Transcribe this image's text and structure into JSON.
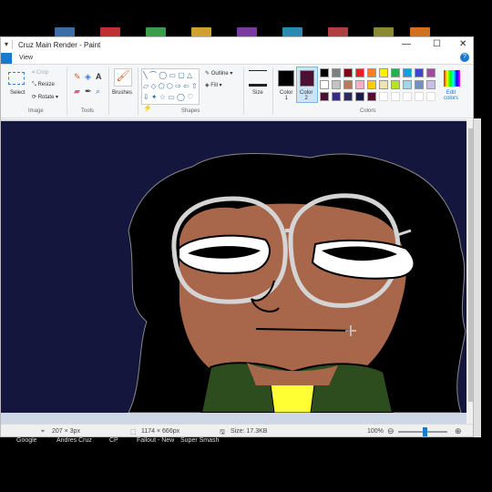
{
  "window": {
    "title": "Cruz Main Render - Paint",
    "quick_access": "▾",
    "minimize": "—",
    "maximize": "☐",
    "close": "✕"
  },
  "tabs": {
    "view": "View",
    "help": "?"
  },
  "ribbon": {
    "image": {
      "select": "Select",
      "crop": "Crop",
      "resize": "Resize",
      "rotate": "Rotate",
      "label": "Image"
    },
    "tools": {
      "label": "Tools"
    },
    "brushes": "Brushes",
    "shapes": {
      "outline": "Outline",
      "fill": "Fill",
      "label": "Shapes"
    },
    "size": "Size",
    "color1": "Color\n1",
    "color1_line1": "Color",
    "color1_line2": "1",
    "color2_line1": "Color",
    "color2_line2": "2",
    "colors_label": "Colors",
    "edit_colors_line1": "Edit",
    "edit_colors_line2": "colors",
    "palette": [
      "#000000",
      "#7f7f7f",
      "#880015",
      "#ed1c24",
      "#ff7f27",
      "#fff200",
      "#22b14c",
      "#00a2e8",
      "#3f48cc",
      "#a349a4",
      "#ffffff",
      "#c3c3c3",
      "#b97a57",
      "#ffaec9",
      "#ffc90e",
      "#efe4b0",
      "#b5e61d",
      "#99d9ea",
      "#7092be",
      "#c8bfe7",
      "#4b1031",
      "#3a2a8a",
      "#2a2a60",
      "#1b1b4a",
      "#520f2f",
      "#ffffff",
      "#ffffff",
      "#ffffff",
      "#ffffff",
      "#ffffff"
    ],
    "color1_value": "#000000",
    "color2_value": "#4b1031"
  },
  "status": {
    "cursor": "207 × 3px",
    "selection": "1174 × 666px",
    "size": "Size: 17.3KB",
    "zoom": "100%",
    "zoom_out": "⊖",
    "zoom_in": "⊕"
  },
  "taskbar": {
    "items": [
      "Google",
      "Andres Cruz",
      "CP",
      "Fallout - New",
      "Super Smash"
    ]
  },
  "colors": {
    "canvas_bg": "#14163e",
    "skin": "#a8664a",
    "hair": "#000000",
    "glasses": "#d4d4d4",
    "shirt": "#2e4d1e",
    "collar": "#ffff33"
  }
}
